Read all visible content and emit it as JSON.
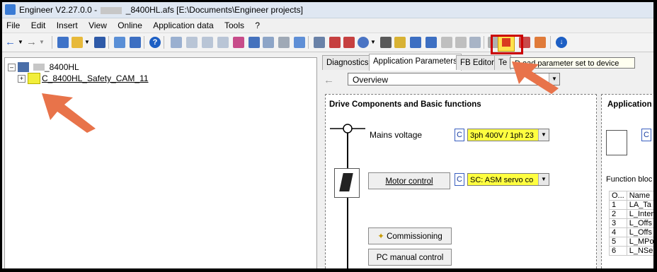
{
  "titlebar": {
    "app": "Engineer V2.27.0.0 -",
    "file": "_8400HL.afs [E:\\Documents\\Engineer projects]"
  },
  "menu": [
    "File",
    "Edit",
    "Insert",
    "View",
    "Online",
    "Application data",
    "Tools",
    "?"
  ],
  "toolbar": {
    "highlight_color": "#cc0000",
    "tooltip": "D   oad parameter set to device"
  },
  "tree": {
    "root_label": "_8400HL",
    "child_label": "C_8400HL_Safety_CAM_11"
  },
  "tabs": [
    "Diagnostics",
    "Application Parameters",
    "FB Editor",
    "Te"
  ],
  "view_select": "Overview",
  "drive_box": {
    "title": "Drive Components and Basic functions",
    "mains_label": "Mains voltage",
    "mains_value": "3ph 400V / 1ph 23",
    "motor_button": "Motor control",
    "motor_value": "SC: ASM servo co",
    "badge": "C",
    "commissioning_button": "Commissioning",
    "pc_manual_button": "PC manual control"
  },
  "application_box": {
    "title": "Application",
    "fb_label": "Function bloc",
    "fb_columns": [
      "O...",
      "Name"
    ],
    "fb_rows": [
      {
        "n": "1",
        "name": "LA_Ta"
      },
      {
        "n": "2",
        "name": "L_Inter"
      },
      {
        "n": "3",
        "name": "L_Offs"
      },
      {
        "n": "4",
        "name": "L_Offs"
      },
      {
        "n": "5",
        "name": "L_MPot"
      },
      {
        "n": "6",
        "name": "L_NSe"
      }
    ]
  },
  "colors": {
    "yellow_field": "#ffff40",
    "arrow": "#e8734a"
  }
}
